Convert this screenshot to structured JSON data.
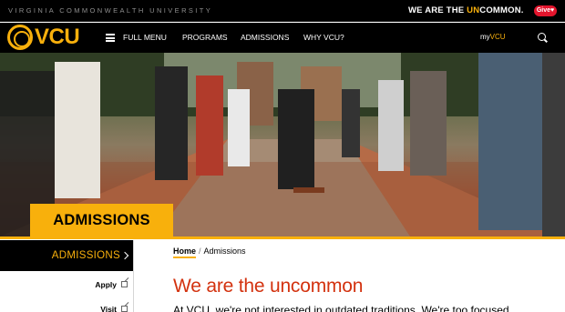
{
  "utility_bar": {
    "university_name": "VIRGINIA COMMONWEALTH UNIVERSITY",
    "tagline_prefix": "WE ARE THE ",
    "tagline_highlight": "UN",
    "tagline_suffix": "COMMON.",
    "give_label": "Give",
    "give_icon": "heart-icon"
  },
  "nav": {
    "logo_text": "VCU",
    "menu_icon": "hamburger-icon",
    "full_menu_label": "FULL MENU",
    "links": [
      "PROGRAMS",
      "ADMISSIONS",
      "WHY VCU?"
    ],
    "my_prefix": "my",
    "my_suffix": "VCU",
    "search_icon": "search-icon"
  },
  "hero": {
    "title": "ADMISSIONS"
  },
  "sidebar": {
    "active_label": "ADMISSIONS",
    "items": [
      {
        "label": "Apply"
      },
      {
        "label": "Visit"
      }
    ]
  },
  "breadcrumb": {
    "home": "Home",
    "separator": "/",
    "current": "Admissions"
  },
  "main": {
    "heading": "We are the uncommon",
    "intro": "At VCU, we're not interested in outdated traditions. We're too focused"
  },
  "colors": {
    "accent": "#f8b00c",
    "heading": "#d3320f",
    "give": "#e4152d",
    "bar": "#000000"
  }
}
